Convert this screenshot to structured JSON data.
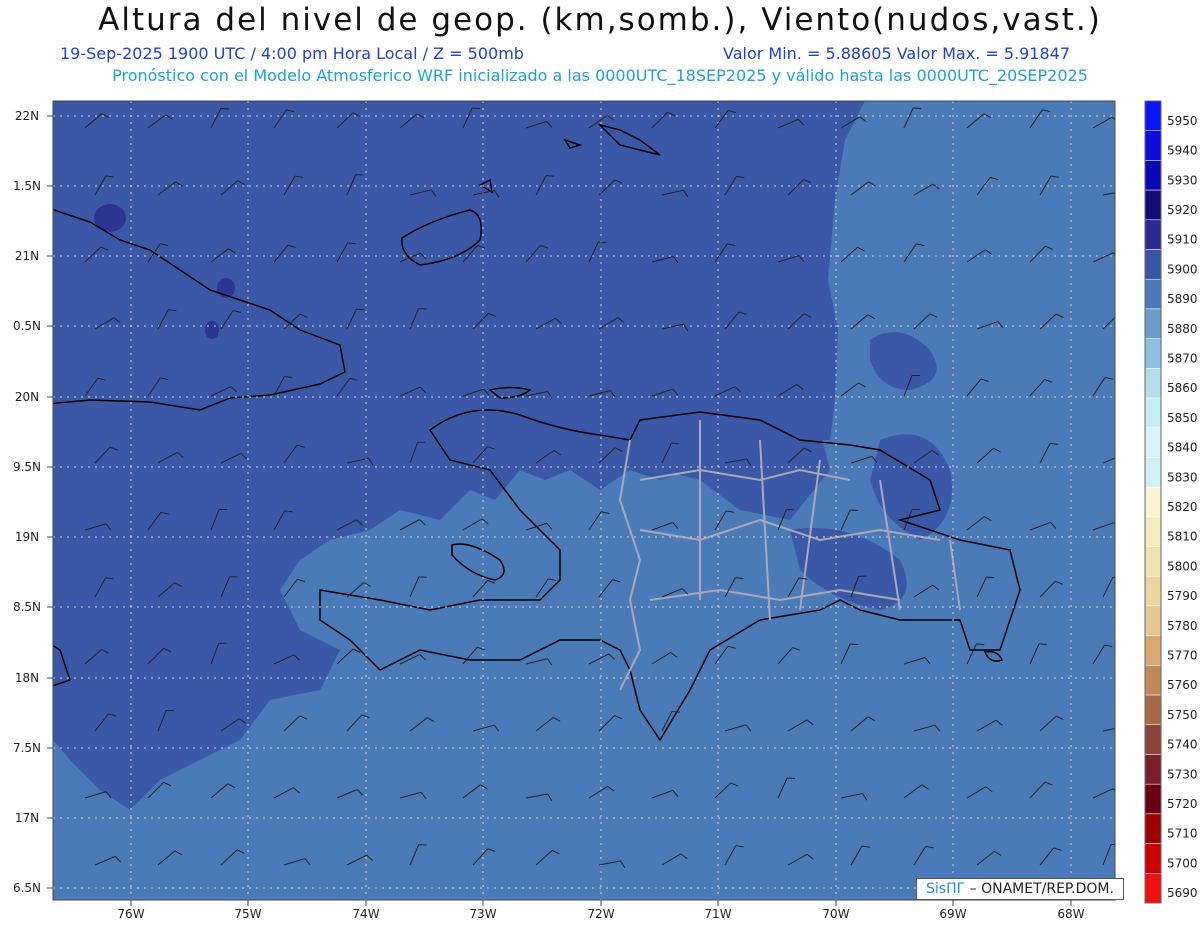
{
  "header": {
    "title": "Altura del nivel de geop. (km,somb.), Viento(nudos,vast.)",
    "valid_time": "19-Sep-2025  1900 UTC / 4:00 pm Hora Local / Z = 500mb",
    "min_max": "Valor Min. = 5.88605  Valor Max. = 5.91847",
    "model_info": "Pronóstico con el Modelo Atmosferico WRF inicializado a las 0000UTC_18SEP2025 y válido hasta las  0000UTC_20SEP2025"
  },
  "axes": {
    "lat_labels": [
      "22N",
      "1.5N",
      "21N",
      "0.5N",
      "20N",
      "9.5N",
      "19N",
      "8.5N",
      "18N",
      "7.5N",
      "17N",
      "6.5N"
    ],
    "lon_labels": [
      "76W",
      "75W",
      "74W",
      "73W",
      "72W",
      "71W",
      "70W",
      "69W",
      "68W"
    ]
  },
  "colorbar": {
    "levels": [
      "5950",
      "5940",
      "5930",
      "5920",
      "5910",
      "5900",
      "5890",
      "5880",
      "5870",
      "5860",
      "5850",
      "5840",
      "5830",
      "5820",
      "5810",
      "5800",
      "5790",
      "5780",
      "5770",
      "5760",
      "5750",
      "5740",
      "5730",
      "5720",
      "5710",
      "5700",
      "5690"
    ],
    "colors": [
      "#0a14ff",
      "#0a0ee0",
      "#0808b8",
      "#140a78",
      "#2a2a90",
      "#3a55a8",
      "#4b7ab8",
      "#6a9ccc",
      "#8fbfe0",
      "#b4def0",
      "#c8eef5",
      "#d8f4f8",
      "#d0f2f6",
      "#fbf4d0",
      "#f5eac0",
      "#f2e2b0",
      "#ecd6a0",
      "#e4c690",
      "#d6aa70",
      "#c08a58",
      "#a8684a",
      "#8e4438",
      "#7a1e28",
      "#6a0010",
      "#a00000",
      "#cc0000",
      "#f01010"
    ]
  },
  "credit": {
    "brand": "SisПГ",
    "text": " – ONAMET/REP.DOM."
  }
}
